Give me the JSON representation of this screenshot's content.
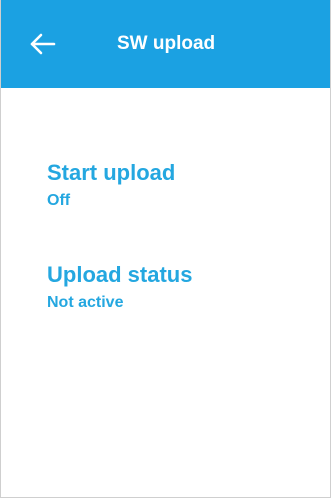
{
  "header": {
    "title": "SW upload",
    "back_icon": "arrow-left-icon",
    "background_color": "#1ba1e2"
  },
  "items": [
    {
      "label": "Start upload",
      "value": "Off"
    },
    {
      "label": "Upload status",
      "value": "Not active"
    }
  ],
  "colors": {
    "accent": "#24a7e0",
    "header_text": "#ffffff",
    "background": "#ffffff"
  }
}
